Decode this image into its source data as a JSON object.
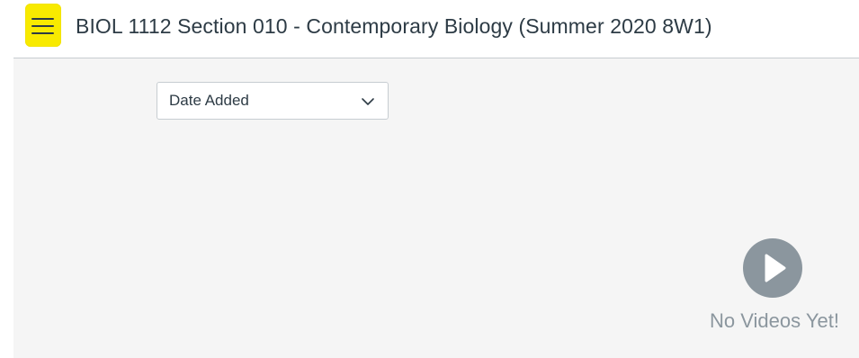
{
  "header": {
    "menu_icon": "hamburger-menu-icon",
    "course_title": "BIOL 1112 Section 010 - Contemporary Biology (Summer 2020 8W1)",
    "menu_highlight_color": "#f8ea00"
  },
  "toolbar": {
    "sort_select": {
      "selected": "Date Added",
      "icon": "chevron-down-icon"
    }
  },
  "empty_state": {
    "icon": "play-circle-icon",
    "message": "No Videos Yet!",
    "color": "#8b969e"
  },
  "colors": {
    "text": "#2d3b45",
    "content_background": "#f5f5f5",
    "border": "#c7cdd1"
  }
}
